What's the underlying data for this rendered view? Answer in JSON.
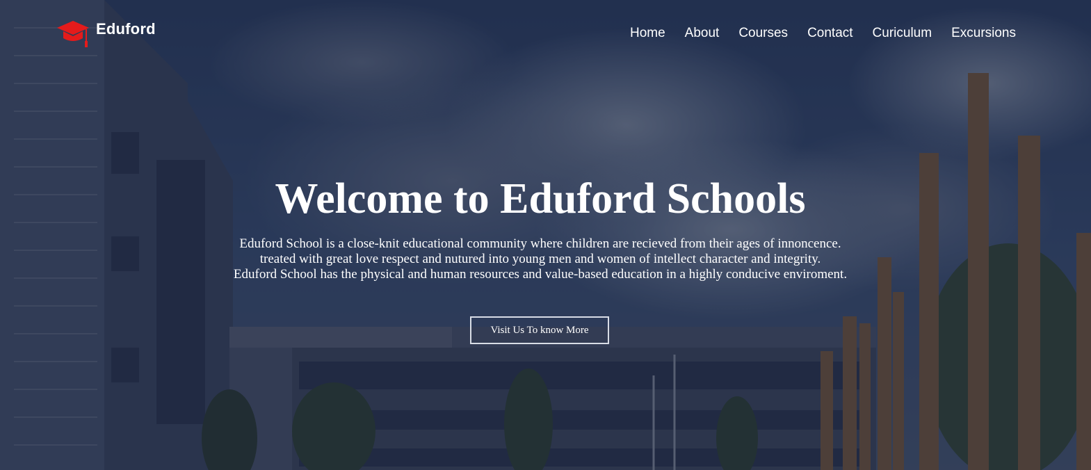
{
  "brand": {
    "name": "Eduford",
    "logo_icon": "graduation-cap-icon",
    "logo_color": "#e51b1b"
  },
  "nav": {
    "items": [
      {
        "label": "Home"
      },
      {
        "label": "About"
      },
      {
        "label": "Courses"
      },
      {
        "label": "Contact"
      },
      {
        "label": "Curiculum"
      },
      {
        "label": "Excursions"
      }
    ]
  },
  "hero": {
    "title": "Welcome to Eduford Schools",
    "description_lines": [
      "Eduford School is a close-knit educational community where children are recieved from their ages of innoncence.",
      "treated with great love respect and nutured into young men and women of intellect character and integrity.",
      "Eduford School has the physical and human resources and value-based education in a highly conducive enviroment."
    ],
    "cta_label": "Visit Us To know More",
    "overlay_color": "#161e34"
  }
}
